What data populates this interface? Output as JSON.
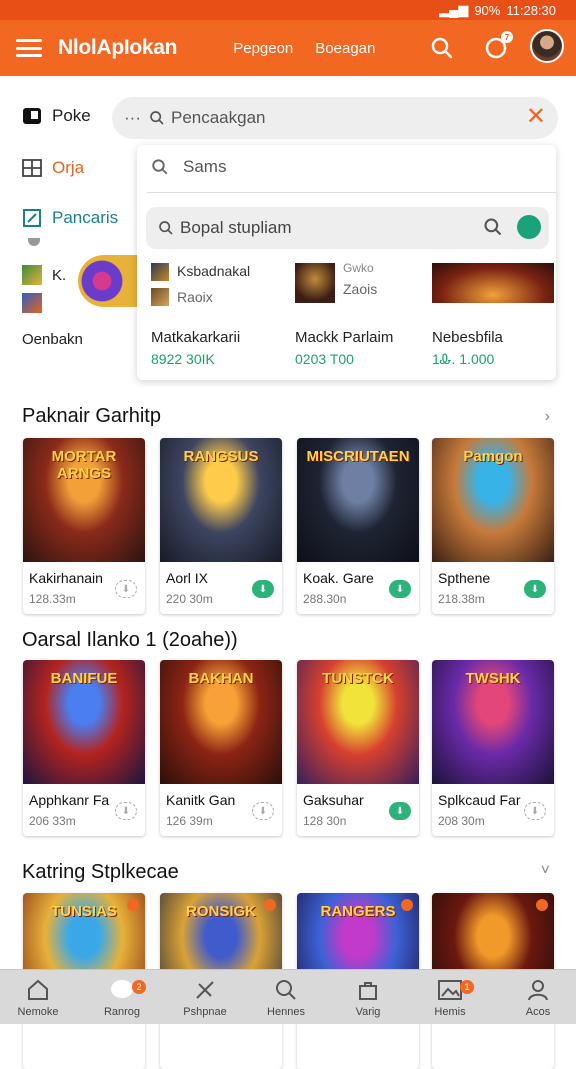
{
  "status": {
    "time": "11:28:30",
    "battery": "90%"
  },
  "header": {
    "title": "NlolApIokan",
    "link1": "Pepgeon",
    "link2": "Boeagan",
    "notif_count": "7"
  },
  "search": {
    "placeholder": "Pencaakgan",
    "prefix": "···"
  },
  "leftnav": {
    "item1": "Poke",
    "item2": "Orja",
    "item3": "Pancaris",
    "item4": "K.",
    "item5": "Oenbakn"
  },
  "dropdown": {
    "suggestion": "Sams",
    "inner_search": "Bopal stupliam",
    "group1": {
      "title": "Ksbadnakal",
      "sub": "Raoix"
    },
    "group2": {
      "title": "Gwko",
      "sub": "Zaois"
    },
    "results": [
      {
        "title": "Matkakarkarii",
        "value": "8922 30IK"
      },
      {
        "title": "Mackk Parlaim",
        "value": "0203 T00"
      },
      {
        "title": "Nebesbfila",
        "value": "1Ꮂ. 1.000"
      }
    ]
  },
  "sections": [
    {
      "title": "Paknair Garhitp",
      "items": [
        {
          "label": "MORTAR ARNGS",
          "name": "Kakirhanain",
          "size": "128.33m",
          "colors": [
            "#f2a038",
            "#8b2a1a",
            "#2b1410"
          ]
        },
        {
          "label": "RANGSUS",
          "name": "Aorl IX",
          "size": "220 30m",
          "colors": [
            "#ffcb4a",
            "#3d4560",
            "#171b26"
          ]
        },
        {
          "label": "MISCRIUTAEN",
          "name": "Koak. Gare",
          "size": "288.30n",
          "colors": [
            "#6e7fa3",
            "#1e2433",
            "#0d0f16"
          ]
        },
        {
          "label": "Pamgon",
          "name": "Spthene",
          "size": "218.38m",
          "colors": [
            "#38b3e8",
            "#c77a3a",
            "#3a1f14"
          ]
        }
      ]
    },
    {
      "title": "Oarsal Ilanko 1 (2oahe))",
      "items": [
        {
          "label": "BANIFUE",
          "name": "Apphkanr Fa",
          "size": "206 33m",
          "colors": [
            "#4b7ef0",
            "#b3231f",
            "#1a1640"
          ]
        },
        {
          "label": "BAKHAN",
          "name": "Kanitk Gan",
          "size": "126 39m",
          "colors": [
            "#f7a136",
            "#8c2414",
            "#2a0f0a"
          ]
        },
        {
          "label": "TUNSTCK",
          "name": "Gaksuhar",
          "size": "128 30n",
          "colors": [
            "#f2e33a",
            "#d7402f",
            "#35205c"
          ]
        },
        {
          "label": "TWSHK",
          "name": "Splkcaud Far",
          "size": "208 30m",
          "colors": [
            "#e2467a",
            "#6a2aa8",
            "#1c1238"
          ]
        }
      ]
    },
    {
      "title": "Katring Stplkecae",
      "items": [
        {
          "label": "TUNSIAS",
          "name": "",
          "size": "",
          "colors": [
            "#3aa8e8",
            "#e8b13a",
            "#7a2212"
          ]
        },
        {
          "label": "RONSIGK",
          "name": "",
          "size": "",
          "colors": [
            "#3f5bcc",
            "#d9a237",
            "#1a2238"
          ]
        },
        {
          "label": "RANGERS",
          "name": "",
          "size": "",
          "colors": [
            "#c23ac9",
            "#3c62d6",
            "#1a1038"
          ]
        },
        {
          "label": "",
          "name": "",
          "size": "",
          "colors": [
            "#f19a2a",
            "#6b1810",
            "#1c0b07"
          ]
        }
      ]
    }
  ],
  "bottomnav": [
    {
      "label": "Nemoke",
      "icon": "home-icon"
    },
    {
      "label": "Ranrog",
      "icon": "chat-icon",
      "badge": "2"
    },
    {
      "label": "Pshpnae",
      "icon": "pen-icon"
    },
    {
      "label": "Hennes",
      "icon": "search-icon"
    },
    {
      "label": "Varig",
      "icon": "bag-icon"
    },
    {
      "label": "Hemis",
      "icon": "gallery-icon",
      "badge": "1"
    },
    {
      "label": "Acos",
      "icon": "user-icon"
    }
  ]
}
